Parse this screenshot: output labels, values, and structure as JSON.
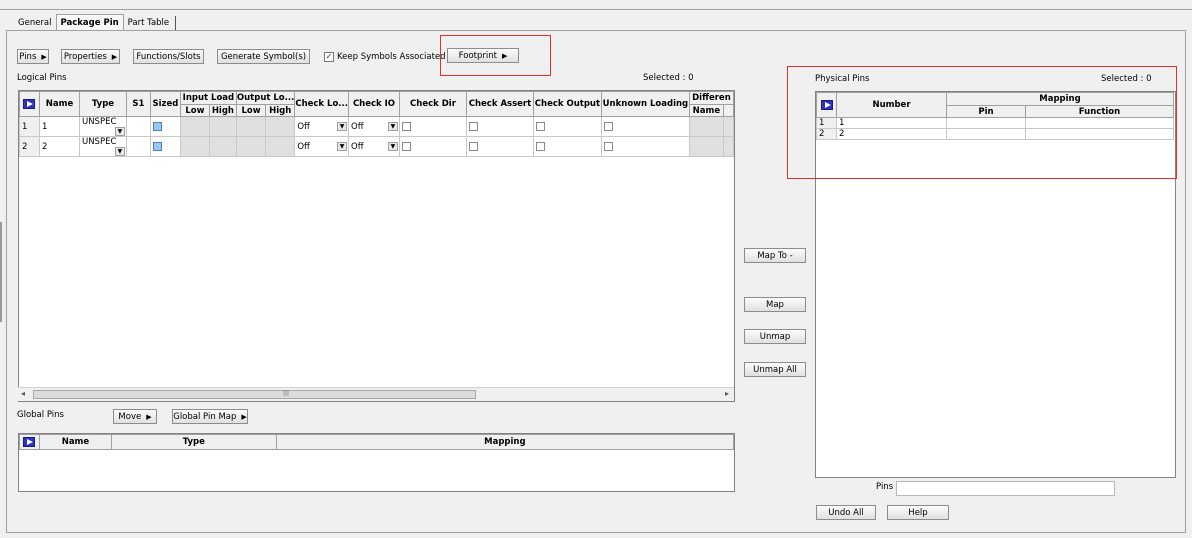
{
  "tabs": [
    "General",
    "Package Pin",
    "Part Table"
  ],
  "active_tab": "Package Pin",
  "toolbar": {
    "pins": "Pins",
    "properties": "Properties",
    "functions_slots": "Functions/Slots",
    "generate_symbols": "Generate Symbol(s)",
    "keep_symbols": "Keep Symbols Associated",
    "keep_symbols_checked": true,
    "footprint": "Footprint"
  },
  "logical": {
    "title": "Logical Pins",
    "selected": "Selected :  0",
    "headers": {
      "name": "Name",
      "type": "Type",
      "s1": "S1",
      "sized": "Sized",
      "input_load": "Input Load",
      "output_load": "Output Lo...",
      "low": "Low",
      "high": "High",
      "check_lo": "Check Lo...",
      "check_io": "Check IO",
      "check_dir": "Check Dir",
      "check_assert": "Check Assert",
      "check_output": "Check Output",
      "unknown_loading": "Unknown Loading",
      "differential": "Differen",
      "diff_name": "Name"
    },
    "rows": [
      {
        "num": "1",
        "name": "1",
        "type": "UNSPEC",
        "check_lo": "Off",
        "check_io": "Off"
      },
      {
        "num": "2",
        "name": "2",
        "type": "UNSPEC",
        "check_lo": "Off",
        "check_io": "Off"
      }
    ]
  },
  "map_buttons": {
    "map_to": "Map To -",
    "map": "Map",
    "unmap": "Unmap",
    "unmap_all": "Unmap All"
  },
  "global": {
    "title": "Global Pins",
    "move": "Move",
    "global_pin_map": "Global Pin Map",
    "headers": {
      "name": "Name",
      "type": "Type",
      "mapping": "Mapping"
    }
  },
  "physical": {
    "title": "Physical Pins",
    "selected": "Selected :  0",
    "headers": {
      "number": "Number",
      "mapping": "Mapping",
      "pin": "Pin",
      "function": "Function"
    },
    "rows": [
      {
        "num": "1",
        "number": "1"
      },
      {
        "num": "2",
        "number": "2"
      }
    ]
  },
  "bottom": {
    "pins_label": "Pins",
    "pins_value": "",
    "undo_all": "Undo All",
    "help": "Help"
  },
  "colors": {
    "highlight_box": "#e03030",
    "corner_icon": "#2b32c8"
  }
}
